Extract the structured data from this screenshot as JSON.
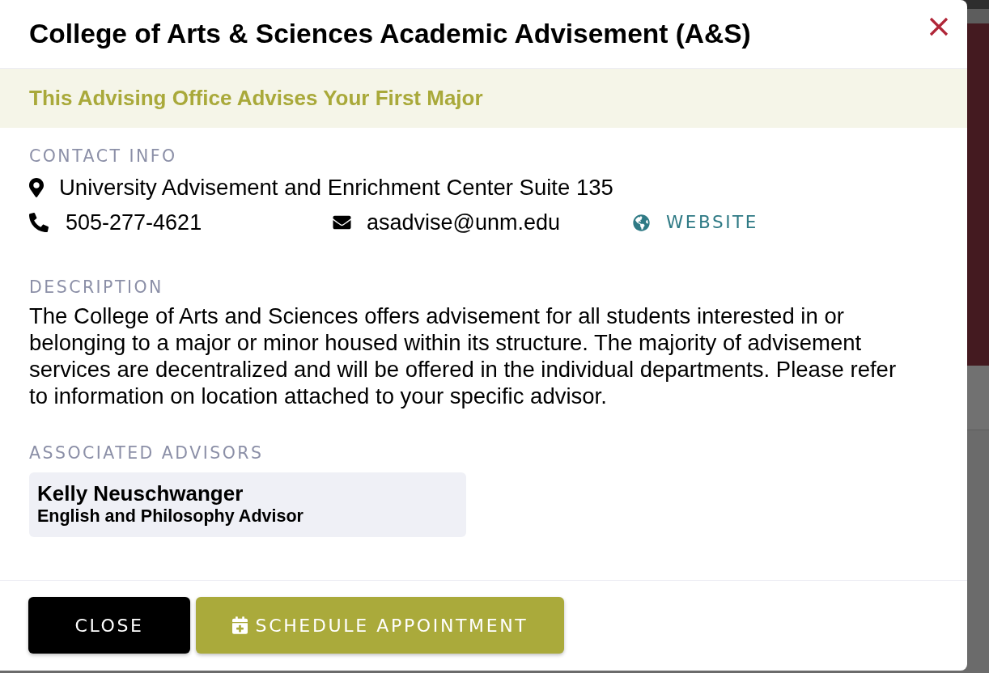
{
  "dialog": {
    "title": "College of Arts & Sciences Academic Advisement (A&S)",
    "banner": "This Advising Office Advises Your First Major"
  },
  "contact_info": {
    "label": "CONTACT INFO",
    "address": "University Advisement and Enrichment Center Suite 135",
    "phone": "505-277-4621",
    "email": "asadvise@unm.edu",
    "website": "WEBSITE"
  },
  "description": {
    "label": "DESCRIPTION",
    "text": "The College of Arts and Sciences offers advisement for all students interested in or belonging to a major or minor housed within its structure. The majority of advisement services are decentralized and will be offered in the individual departments. Please refer to information on location attached to your specific advisor."
  },
  "associated_advisors": {
    "label": "ASSOCIATED ADVISORS",
    "advisors": [
      {
        "name": "Kelly Neuschwanger",
        "title": "English and Philosophy Advisor"
      }
    ]
  },
  "buttons": [
    {
      "label": "CLOSE",
      "kind": "secondary"
    },
    {
      "label": "SCHEDULE APPOINTMENT",
      "kind": "primary"
    }
  ]
}
